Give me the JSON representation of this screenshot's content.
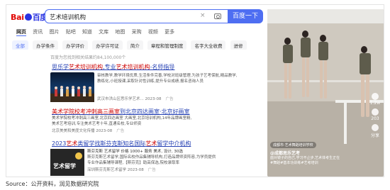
{
  "header": {
    "logo_left": "Bai",
    "logo_right": "百度",
    "query": "艺术培训机构",
    "search_button": "百度一下"
  },
  "tabs": [
    "网页",
    "资讯",
    "图片",
    "贴吧",
    "知道",
    "文库",
    "地图",
    "采购",
    "视频",
    "更多"
  ],
  "filters": [
    "全部",
    "办学条件",
    "办学评价",
    "办学许可证",
    "简介",
    "章程和管理制度",
    "名字大全收费",
    "进修"
  ],
  "result_count": "百度为您找到相关结果约84,100,000个",
  "results": [
    {
      "title_a": "思乐学",
      "title_em": "艺术培训机构",
      "title_b": ",专业",
      "title_em2": "艺术培训机构",
      "title_c": "-名师指导",
      "body1": "审核教学,教学环境优质,生活条件完善,学校对班级管理,为孩子艺考保航,精品教学,",
      "body2": "教练化,小班授课,采取针对性训练,提升专业成绩,报名咨询人员",
      "source": "武汉市洪山区思乐学艺术... 2023-08",
      "ad": "广告"
    },
    {
      "title_a": "美术学院校考冲刺高三画室",
      "title_b": "",
      "title_c": "到北京四达画室·北京好画室",
      "body1": "美术学院校考冲刺高三画室,北京四达画室 大画室,北京培训机构,14年品牌画室精,",
      "body2": "美术艺考培训,专注美术艺考十年,直通名校,专业师资",
      "source": "北京美美和美度文化传播 2023-08",
      "ad": "广告"
    },
    {
      "title_a": "2023",
      "title_em": "艺术",
      "title_b": "类留学找斯芬克斯知名国际",
      "title_em2": "艺术",
      "title_c": "留学中介机构",
      "meta": "斯芬克斯 艺术留学 价格 1000+ 服务 美术, 设计, 30选",
      "body1": "斯芬克斯艺术留学,国际名校作品集辅导机构,打造品牌师资阵容,为学员提供",
      "body2": "专业作品集辅导课程,【斯芬克】助高保选,院校录取率",
      "source": "深圳斯芬克斯艺术留学 2023-08",
      "ad": "广告"
    }
  ],
  "thumb_labels": [
    "艺术留学"
  ],
  "video": {
    "location": "成都市·艺术舞蹈培训学校",
    "author": "@成都思乐艺考",
    "caption1": "面对镜子的自己,学习不止步,艺术体考生正在",
    "caption2": "#舞蹈#基本功训练#艺考培训",
    "likes": "1.2w",
    "comments": "203",
    "shares": "分享"
  },
  "source_note": "Source：公开资料，润见数据研究院"
}
